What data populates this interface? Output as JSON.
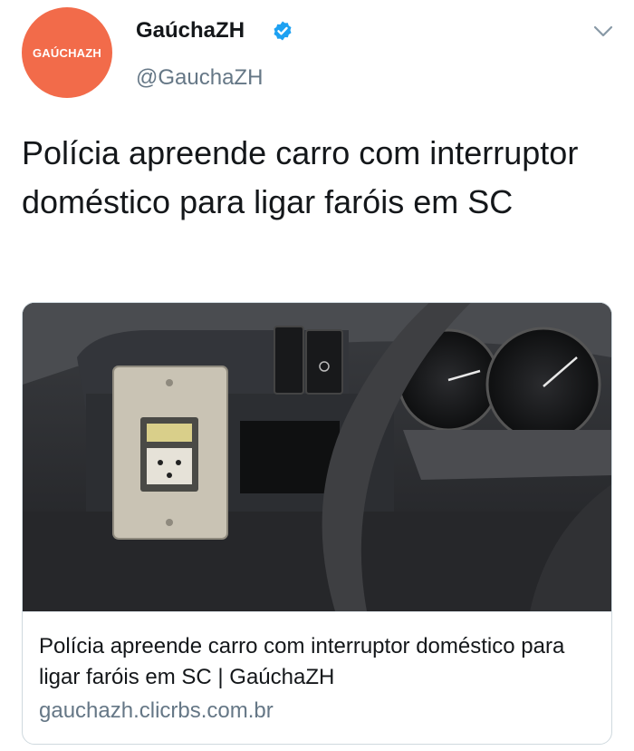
{
  "account": {
    "avatar_text": "GAÚCHAZH",
    "display_name": "GaúchaZH",
    "handle": "@GauchaZH",
    "verified": true
  },
  "icons": {
    "verified": "verified-badge-icon",
    "menu": "chevron-down-icon"
  },
  "tweet": {
    "text": "Polícia apreende carro com interruptor doméstico para ligar faróis em SC"
  },
  "card": {
    "image_alt": "photo of car dashboard with a household light switch installed next to the steering wheel",
    "title": "Polícia apreende carro com interruptor doméstico para ligar faróis em SC | GaúchaZH",
    "domain": "gauchazh.clicrbs.com.br"
  },
  "colors": {
    "brand": "#f26b4a",
    "verified": "#1da1f2",
    "secondary_text": "#657786",
    "primary_text": "#14171a",
    "border": "#cfd9de"
  }
}
